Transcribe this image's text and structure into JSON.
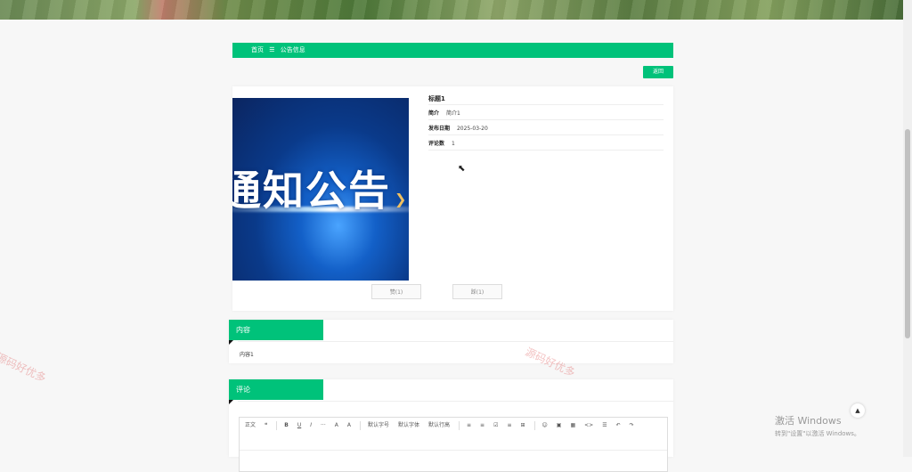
{
  "breadcrumb": {
    "home": "首页",
    "separator": "☰",
    "current": "公告信息"
  },
  "back_button": "返回",
  "detail": {
    "title": "标题1",
    "fields": [
      {
        "key": "简介",
        "value": "简介1"
      },
      {
        "key": "发布日期",
        "value": "2025-03-20"
      },
      {
        "key": "评论数",
        "value": "1"
      }
    ],
    "carousel_text": "通知公告",
    "like_button": "赞(1)",
    "dislike_button": "踩(1)"
  },
  "content_section": {
    "tab": "内容",
    "text": "内容1"
  },
  "comment_section": {
    "tab": "评论",
    "toolbar": [
      "正文",
      "❝",
      "B",
      "U",
      "I",
      "···",
      "A",
      "A",
      "默认字号",
      "默认字体",
      "默认行高",
      "≡",
      "≡",
      "☑",
      "≡",
      "⊞",
      "☺",
      "▣",
      "▦",
      "<>",
      "☰",
      "↶",
      "↷"
    ]
  },
  "watermark": "源码好优多",
  "windows_activation": {
    "line1": "激活 Windows",
    "line2": "转到\"设置\"以激活 Windows。"
  },
  "back_to_top_icon": "▲",
  "colors": {
    "accent": "#00c27a"
  }
}
